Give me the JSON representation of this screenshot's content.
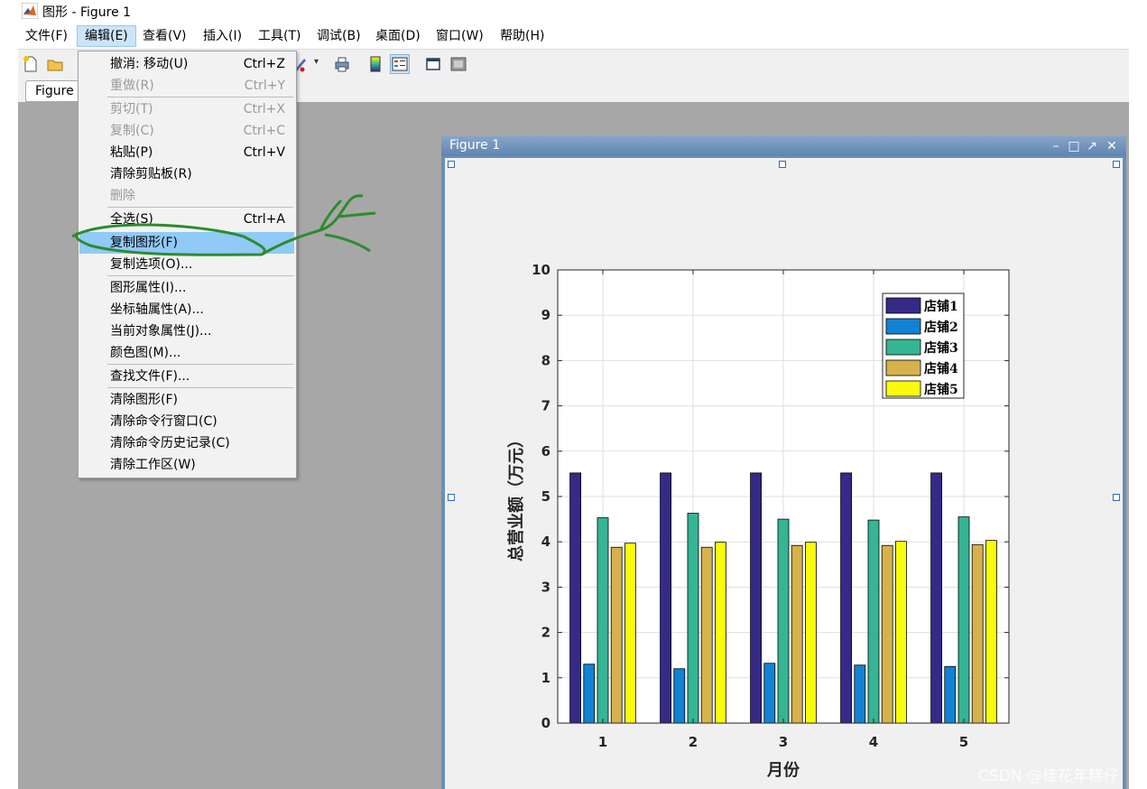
{
  "window": {
    "title": "图形 - Figure 1"
  },
  "menubar": [
    {
      "label": "文件(F)"
    },
    {
      "label": "编辑(E)"
    },
    {
      "label": "查看(V)"
    },
    {
      "label": "插入(I)"
    },
    {
      "label": "工具(T)"
    },
    {
      "label": "调试(B)"
    },
    {
      "label": "桌面(D)"
    },
    {
      "label": "窗口(W)"
    },
    {
      "label": "帮助(H)"
    }
  ],
  "figure_tab": {
    "label": "Figure"
  },
  "edit_menu": {
    "items": [
      {
        "label": "撤消: 移动(U)",
        "shortcut": "Ctrl+Z"
      },
      {
        "label": "重做(R)",
        "shortcut": "Ctrl+Y"
      },
      {
        "label": "剪切(T)",
        "shortcut": "Ctrl+X"
      },
      {
        "label": "复制(C)",
        "shortcut": "Ctrl+C"
      },
      {
        "label": "粘贴(P)",
        "shortcut": "Ctrl+V"
      },
      {
        "label": "清除剪贴板(R)",
        "shortcut": ""
      },
      {
        "label": "删除",
        "shortcut": ""
      },
      {
        "label": "全选(S)",
        "shortcut": "Ctrl+A"
      },
      {
        "label": "复制图形(F)",
        "shortcut": ""
      },
      {
        "label": "复制选项(O)...",
        "shortcut": ""
      },
      {
        "label": "图形属性(I)...",
        "shortcut": ""
      },
      {
        "label": "坐标轴属性(A)...",
        "shortcut": ""
      },
      {
        "label": "当前对象属性(J)...",
        "shortcut": ""
      },
      {
        "label": "颜色图(M)...",
        "shortcut": ""
      },
      {
        "label": "查找文件(F)...",
        "shortcut": ""
      },
      {
        "label": "清除图形(F)",
        "shortcut": ""
      },
      {
        "label": "清除命令行窗口(C)",
        "shortcut": ""
      },
      {
        "label": "清除命令历史记录(C)",
        "shortcut": ""
      },
      {
        "label": "清除工作区(W)",
        "shortcut": ""
      }
    ]
  },
  "figure_window": {
    "title": "Figure 1"
  },
  "chart_data": {
    "type": "bar",
    "categories": [
      "1",
      "2",
      "3",
      "4",
      "5"
    ],
    "series": [
      {
        "name": "店铺1",
        "color": "#352a87",
        "values": [
          5.52,
          5.52,
          5.52,
          5.52,
          5.52
        ]
      },
      {
        "name": "店铺2",
        "color": "#1282d4",
        "values": [
          1.3,
          1.2,
          1.32,
          1.28,
          1.25
        ]
      },
      {
        "name": "店铺3",
        "color": "#35b595",
        "values": [
          4.53,
          4.63,
          4.5,
          4.48,
          4.55
        ]
      },
      {
        "name": "店铺4",
        "color": "#d6b24c",
        "values": [
          3.88,
          3.88,
          3.92,
          3.92,
          3.94
        ]
      },
      {
        "name": "店铺5",
        "color": "#f9fb0e",
        "values": [
          3.97,
          3.99,
          3.99,
          4.01,
          4.03
        ]
      }
    ],
    "xlabel": "月份",
    "ylabel": "总营业额（万元）",
    "ylim": [
      0,
      10
    ],
    "yticks": [
      0,
      1,
      2,
      3,
      4,
      5,
      6,
      7,
      8,
      9,
      10
    ],
    "grid": true,
    "legend_position": "top-right"
  },
  "watermark": {
    "text": "CSDN @桂花年糕仔"
  },
  "colors": {
    "workspace": "#a7a7a7",
    "menu_highlight": "#91c9f7",
    "annotation_stroke": "#2e8b2e"
  }
}
